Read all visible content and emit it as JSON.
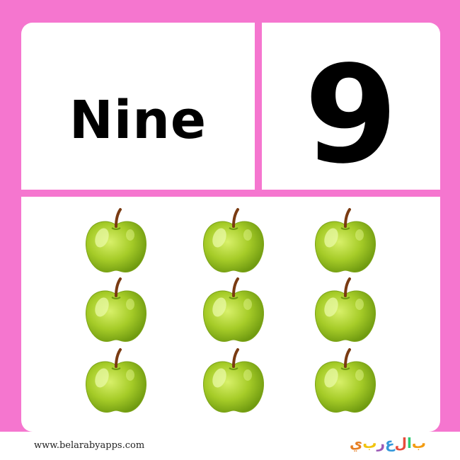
{
  "card": {
    "word": "Nine",
    "numeral": "9",
    "apple_count": 9,
    "item_icon": "green-apple-icon"
  },
  "footer": {
    "url": "www.belarabyapps.com",
    "logo_text": "بالعربي",
    "logo_colors": [
      "#f39c12",
      "#2ecc71",
      "#e74c3c",
      "#3498db",
      "#9b59b6",
      "#f1c40f",
      "#e67e22"
    ]
  },
  "colors": {
    "background": "#f576cf",
    "card": "#ffffff",
    "apple": "#9bc421"
  }
}
